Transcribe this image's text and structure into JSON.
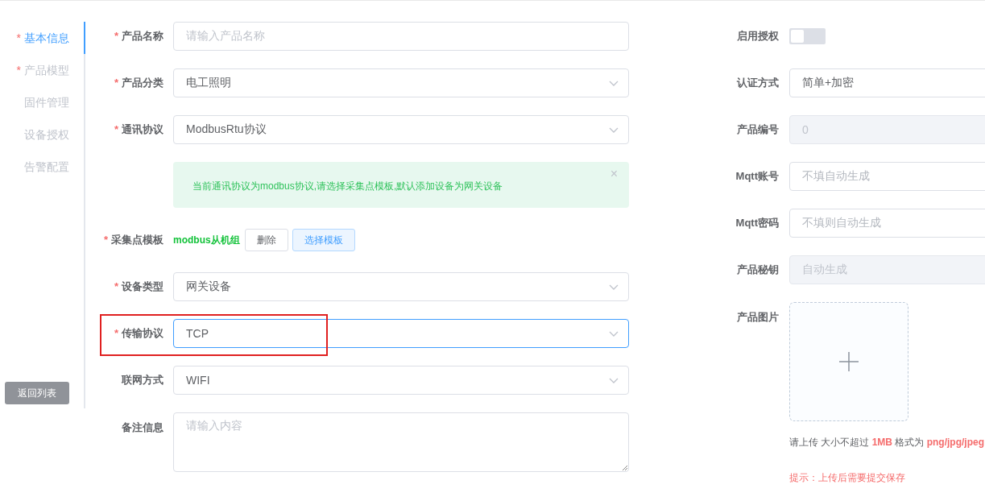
{
  "nav": {
    "items": [
      {
        "label": "基本信息",
        "required_mark": "*",
        "selected": true
      },
      {
        "label": "产品模型",
        "required_mark": "*",
        "selected": false
      },
      {
        "label": "固件管理",
        "selected": false
      },
      {
        "label": "设备授权",
        "selected": false
      },
      {
        "label": "告警配置",
        "selected": false
      }
    ],
    "back_button": "返回列表"
  },
  "form": {
    "fields": [
      {
        "kind": "input",
        "label": "产品名称",
        "required_mark": "*",
        "placeholder": "请输入产品名称",
        "focused": false,
        "highlighted": false
      },
      {
        "kind": "select",
        "label": "产品分类",
        "required_mark": "*",
        "value": "电工照明",
        "focused": false,
        "highlighted": false
      },
      {
        "kind": "select",
        "label": "通讯协议",
        "required_mark": "*",
        "value": "ModbusRtu协议",
        "focused": false,
        "highlighted": false
      },
      {
        "kind": "alert",
        "text": "当前通讯协议为modbus协议,请选择采集点模板,默认添加设备为网关设备",
        "close": "×"
      },
      {
        "kind": "template",
        "label": "采集点模板",
        "required_mark": "*",
        "value": "modbus从机组",
        "buttons": [
          {
            "label": "删除",
            "primary": false
          },
          {
            "label": "选择模板",
            "primary": true
          }
        ]
      },
      {
        "kind": "select",
        "label": "设备类型",
        "required_mark": "*",
        "value": "网关设备",
        "focused": false,
        "highlighted": false
      },
      {
        "kind": "select",
        "label": "传输协议",
        "required_mark": "*",
        "value": "TCP",
        "focused": true,
        "highlighted": true
      },
      {
        "kind": "select",
        "label": "联网方式",
        "value": "WIFI",
        "focused": false,
        "highlighted": false
      },
      {
        "kind": "textarea",
        "label": "备注信息",
        "placeholder": "请输入内容",
        "focused": false,
        "highlighted": false
      }
    ]
  },
  "side": {
    "fields": [
      {
        "kind": "switch",
        "label": "启用授权",
        "on": false
      },
      {
        "kind": "select",
        "label": "认证方式",
        "value": "简单+加密",
        "disabled": false
      },
      {
        "kind": "input",
        "label": "产品编号",
        "value": "0",
        "disabled": true
      },
      {
        "kind": "input",
        "label": "Mqtt账号",
        "placeholder": "不填自动生成",
        "disabled": false
      },
      {
        "kind": "input",
        "label": "Mqtt密码",
        "placeholder": "不填则自动生成",
        "disabled": false
      },
      {
        "kind": "input",
        "label": "产品秘钥",
        "placeholder": "自动生成",
        "disabled": true
      },
      {
        "kind": "upload",
        "label": "产品图片"
      }
    ],
    "upload_hint": "请上传 大小不超过 **1MB** 格式为 **png/jpg/jpeg**",
    "upload_tip": "提示：上传后需要提交保存"
  }
}
